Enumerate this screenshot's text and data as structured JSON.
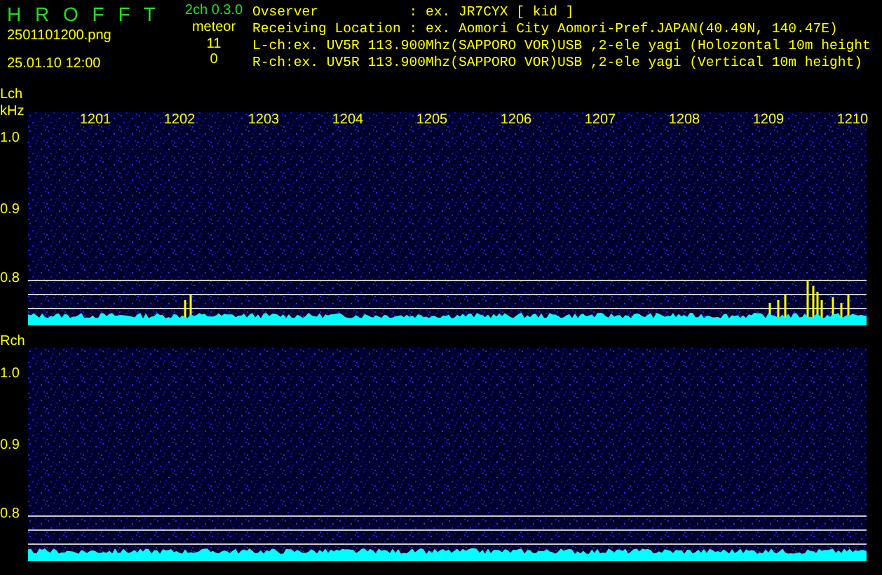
{
  "header": {
    "title": "H R O F F T",
    "filename": "2501101200.png",
    "datetime": "25.01.10 12:00",
    "version": "2ch 0.3.0",
    "counter_label": "meteor",
    "counts": [
      "11",
      "0"
    ],
    "info_lines": [
      "Ovserver           : ex. JR7CYX [ kid ]",
      "Receiving Location : ex. Aomori City Aomori-Pref.JAPAN(40.49N, 140.47E)",
      "L-ch:ex. UV5R 113.900Mhz(SAPPORO VOR)USB ,2-ele yagi (Holozontal 10m height",
      "R-ch:ex. UV5R 113.900Mhz(SAPPORO VOR)USB ,2-ele yagi (Vertical 10m height)"
    ]
  },
  "panels": [
    {
      "channel": "Lch",
      "unit": "kHz",
      "time_labels": [
        "1201",
        "1202",
        "1203",
        "1204",
        "1205",
        "1206",
        "1207",
        "1208",
        "1209",
        "1210"
      ],
      "y_labels": [
        "1.0",
        "0.9",
        "0.8"
      ]
    },
    {
      "channel": "Rch",
      "y_labels": [
        "1.0",
        "0.9",
        "0.8"
      ]
    }
  ]
}
